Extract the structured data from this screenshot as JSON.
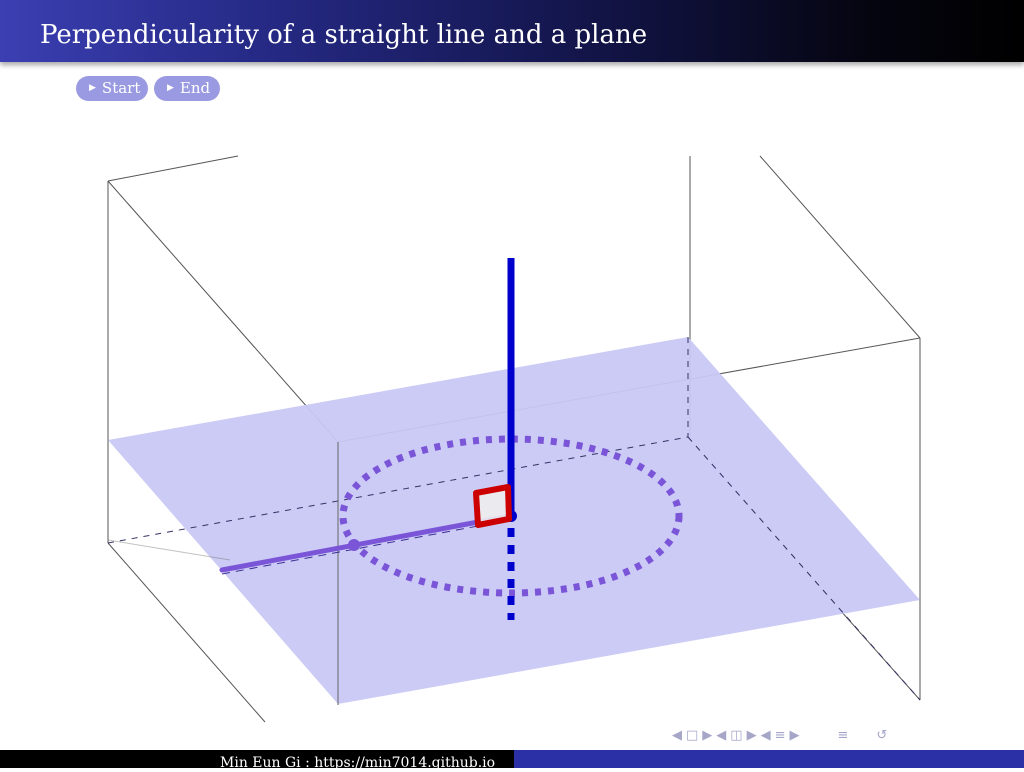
{
  "header": {
    "title": "Perpendicularity of a straight line and a plane"
  },
  "buttons": {
    "start_label": "Start",
    "end_label": "End"
  },
  "footer": {
    "author_url": "Min Eun Gi : https://min7014.github.io"
  },
  "colors": {
    "header_start": "#3b3fb2",
    "button_bg": "#9a9ae2",
    "plane_fill": "#c8c8f4",
    "axis_line": "#0000cc",
    "in_plane_line": "#7b55d8",
    "right_angle_marker": "#cc0000",
    "footer_right": "#2c30a6"
  },
  "nav_icons": [
    "nav-slide-left-icon",
    "nav-frame-icon",
    "nav-slide-right-icon",
    "nav-subsection-left-icon",
    "nav-subsection-icon",
    "nav-subsection-right-icon",
    "nav-section-left-icon",
    "nav-section-icon",
    "nav-section-right-icon",
    "nav-section-list-icon",
    "nav-search-icon"
  ]
}
